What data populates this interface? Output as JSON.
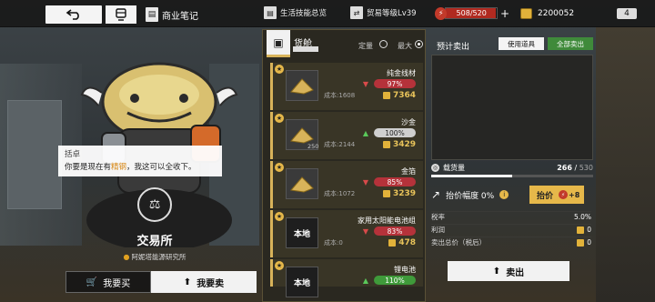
{
  "topbar": {
    "back_icon": "back-arrow-icon",
    "train_icon": "train-icon",
    "notebook_label": "商业笔记",
    "skill_label": "生活技能总览",
    "trade_level": "贸易等级Lv39",
    "stamina_current": 508,
    "stamina_max": 520,
    "stamina_text": "508/520",
    "stamina_plus": "+",
    "coins": "2200052",
    "badge": "4"
  },
  "npc": {
    "name": "括卓",
    "msg_before": "你要是现在有",
    "msg_highlight": "精钢",
    "msg_after": "，我这可以全收下。"
  },
  "station": {
    "title": "交易所",
    "location": "阿妮塔能源研究所"
  },
  "tabs": {
    "buy": "我要买",
    "sell": "我要卖"
  },
  "cargo": {
    "title": "货舱",
    "qty_fixed": "定量",
    "qty_max": "最大",
    "cost_prefix": "成本:",
    "items": [
      {
        "name": "纯金线材",
        "pct": "97%",
        "trend": "down",
        "cost": "1608",
        "price": "7364",
        "qty": "",
        "thumb": ""
      },
      {
        "name": "沙金",
        "pct": "100%",
        "trend": "up",
        "cost": "2144",
        "price": "3429",
        "qty": "250",
        "thumb": ""
      },
      {
        "name": "金箔",
        "pct": "85%",
        "trend": "down",
        "cost": "1072",
        "price": "3239",
        "qty": "",
        "thumb": ""
      },
      {
        "name": "家用太阳能电池组",
        "pct": "83%",
        "trend": "down",
        "cost": "0",
        "price": "478",
        "qty": "",
        "thumb": "本地"
      },
      {
        "name": "锂电池",
        "pct": "110%",
        "trend": "up",
        "cost": "",
        "price": "",
        "qty": "",
        "thumb": "本地"
      }
    ]
  },
  "right": {
    "title": "预计卖出",
    "use_item": "使用道具",
    "sell_all": "全部卖出",
    "load_label": "载货量",
    "load_current": 266,
    "load_max": 530,
    "load_current_text": "266",
    "load_max_text": "530",
    "raise_label": "抬价幅度 0%",
    "raise_btn": "抬价",
    "raise_cost": "+8",
    "rows": [
      {
        "label": "税率",
        "value": "5.0%"
      },
      {
        "label": "利润",
        "value": "0"
      },
      {
        "label": "卖出总价（税后）",
        "value": "0"
      }
    ],
    "sell_btn": "卖出"
  }
}
